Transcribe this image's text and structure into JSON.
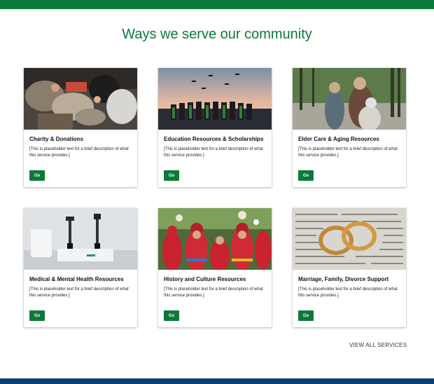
{
  "page": {
    "title": "Ways we serve our community"
  },
  "colors": {
    "brand_green": "#0b7a39",
    "footer_blue": "#0b3f73"
  },
  "services": [
    {
      "title": "Charity & Donations",
      "description": "[This is placeholder text for a brief description of what this service provides.]",
      "button": "Go",
      "image": "charity-donations-photo"
    },
    {
      "title": "Education Resources & Scholarships",
      "description": "[This is placeholder text for a brief description of what this service provides.]",
      "button": "Go",
      "image": "graduation-photo"
    },
    {
      "title": "Elder Care & Aging Resources",
      "description": "[This is placeholder text for a brief description of what this service provides.]",
      "button": "Go",
      "image": "elder-care-photo"
    },
    {
      "title": "Medical & Mental Health Resources",
      "description": "[This is placeholder text for a brief description of what this service provides.]",
      "button": "Go",
      "image": "medical-equipment-photo"
    },
    {
      "title": "History and Culture Resources",
      "description": "[This is placeholder text for a brief description of what this service provides.]",
      "button": "Go",
      "image": "cultural-festival-photo"
    },
    {
      "title": "Marriage, Family, Divorce Support",
      "description": "[This is placeholder text for a brief description of what this service provides.]",
      "button": "Go",
      "image": "wedding-rings-photo"
    }
  ],
  "footer_link": {
    "label": "VIEW ALL SERVICES"
  }
}
